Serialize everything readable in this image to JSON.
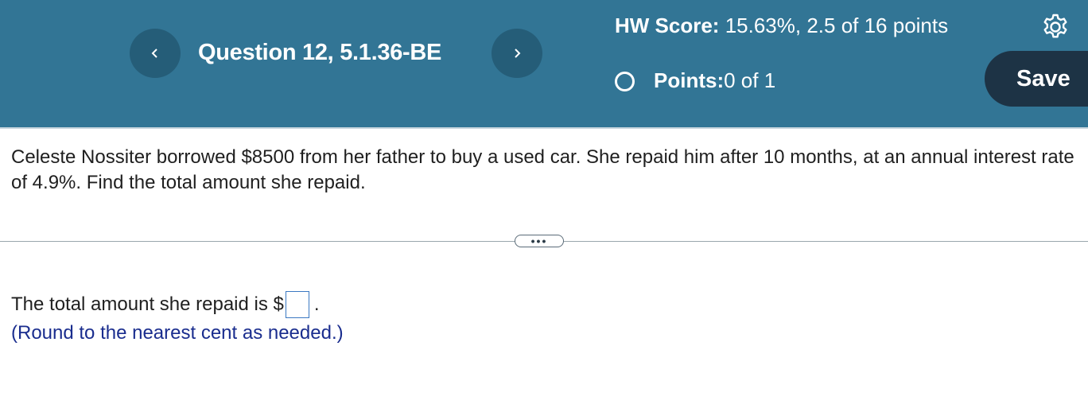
{
  "header": {
    "prev_icon": "chevron-left-icon",
    "next_icon": "chevron-right-icon",
    "question_title": "Question 12, 5.1.36-BE",
    "hw_score_label": "HW Score:",
    "hw_score_value": " 15.63%, 2.5 of 16 points",
    "points_label": "Points:",
    "points_value": " 0 of 1",
    "settings_icon": "gear-icon",
    "save_label": "Save",
    "colors": {
      "bar": "#327595",
      "nav_button": "#255d78",
      "save_button": "#1d3345"
    }
  },
  "question": {
    "text": "Celeste Nossiter borrowed $8500 from her father to buy a used car. She repaid him after 10 months, at an annual interest rate of 4.9%. Find the total amount she repaid.",
    "expand_label": "•••"
  },
  "answer": {
    "prefix": "The total amount she repaid is $",
    "value": "",
    "suffix": ".",
    "hint": "(Round to the nearest cent as needed.)"
  }
}
